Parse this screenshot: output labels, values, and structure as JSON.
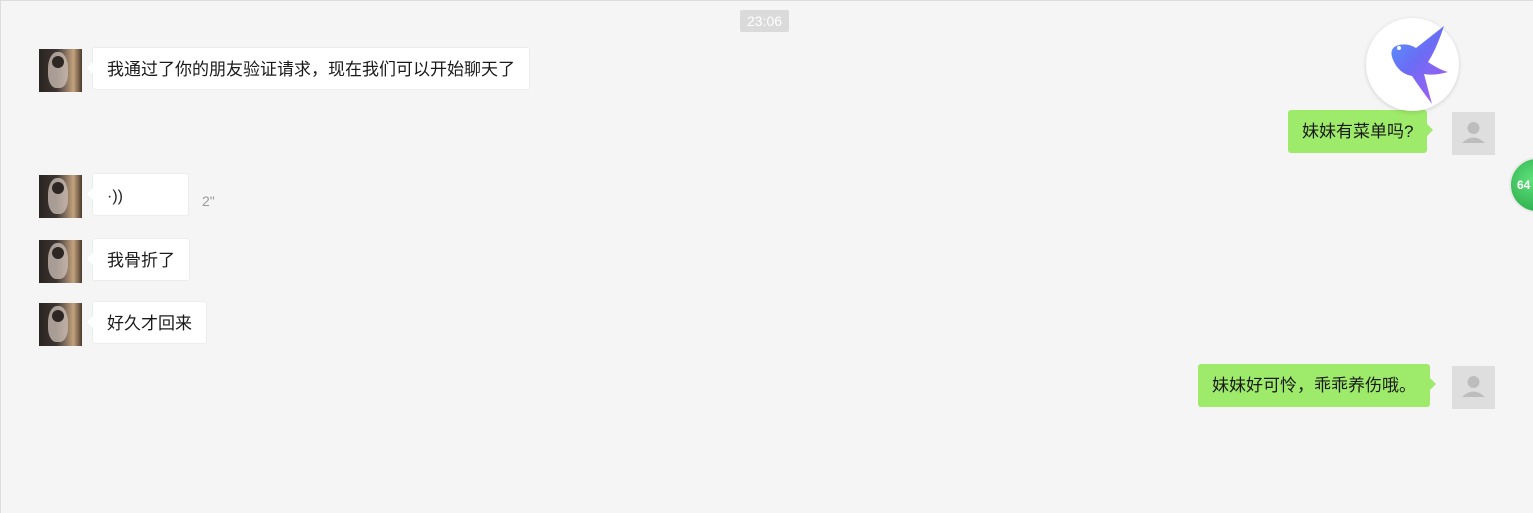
{
  "chat": {
    "timestamp": "23:06",
    "messages": [
      {
        "from": "contact",
        "type": "text",
        "text": "我通过了你的朋友验证请求，现在我们可以开始聊天了"
      },
      {
        "from": "self",
        "type": "text",
        "text": "妹妹有菜单吗?"
      },
      {
        "from": "contact",
        "type": "voice",
        "wave": "·))",
        "duration": "2\""
      },
      {
        "from": "contact",
        "type": "text",
        "text": "我骨折了"
      },
      {
        "from": "contact",
        "type": "text",
        "text": "好久才回来"
      },
      {
        "from": "self",
        "type": "text",
        "text": "妹妹好可怜，乖乖养伤哦。"
      }
    ]
  },
  "floating_widget": {
    "badge_text": "64",
    "icon": "hummingbird-logo-icon"
  },
  "colors": {
    "background": "#f5f5f5",
    "incoming_bubble": "#ffffff",
    "outgoing_bubble": "#9eea6a",
    "timestamp_bg": "#dadada"
  }
}
